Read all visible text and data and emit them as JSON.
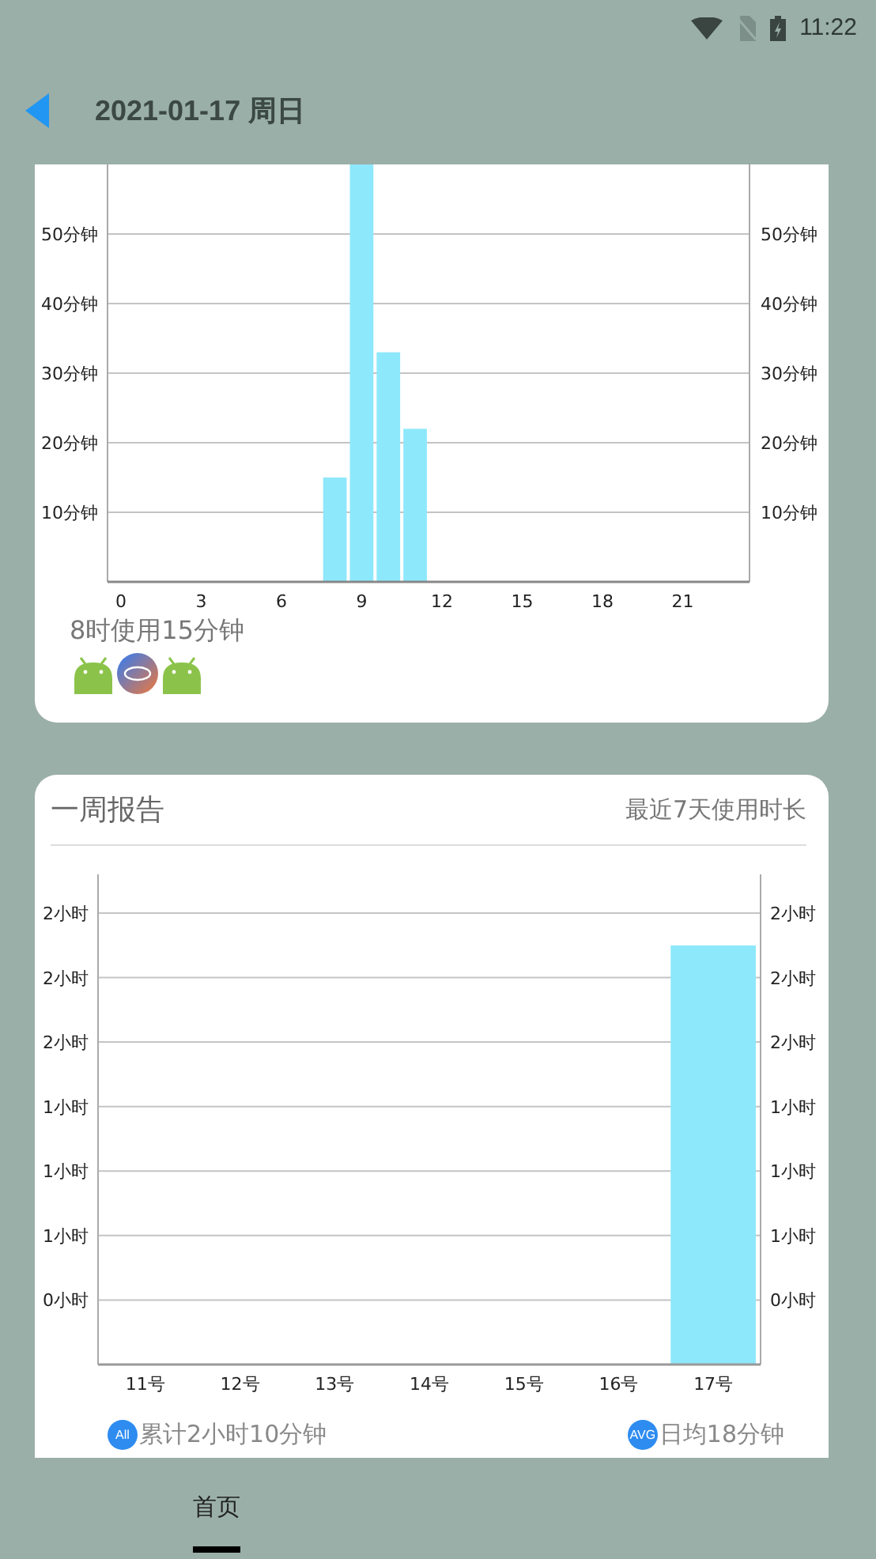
{
  "status_bar": {
    "time": "11:22"
  },
  "header": {
    "title": "2021-01-17 周日"
  },
  "day_card": {
    "chart_data": {
      "type": "bar",
      "x": [
        0,
        1,
        2,
        3,
        4,
        5,
        6,
        7,
        8,
        9,
        10,
        11,
        12,
        13,
        14,
        15,
        16,
        17,
        18,
        19,
        20,
        21,
        22,
        23
      ],
      "series": [
        {
          "color": "#8ee8fb",
          "values": [
            0,
            0,
            0,
            0,
            0,
            0,
            0,
            0,
            15,
            60,
            33,
            22,
            0,
            0,
            0,
            0,
            0,
            0,
            0,
            0,
            0,
            0,
            0,
            0
          ]
        }
      ],
      "grid": true,
      "xlim": [
        -0.5,
        23.5
      ],
      "ylim": [
        0,
        60
      ],
      "xticks": [
        0,
        3,
        6,
        9,
        12,
        15,
        18,
        21
      ],
      "yticks": [
        {
          "value": 10,
          "label": "10分钟"
        },
        {
          "value": 20,
          "label": "20分钟"
        },
        {
          "value": 30,
          "label": "30分钟"
        },
        {
          "value": 40,
          "label": "40分钟"
        },
        {
          "value": 50,
          "label": "50分钟"
        }
      ]
    },
    "caption": "8时使用15分钟",
    "apps": [
      {
        "kind": "android"
      },
      {
        "kind": "nox"
      },
      {
        "kind": "android"
      }
    ]
  },
  "week_card": {
    "title": "一周报告",
    "subtitle": "最近7天使用时长",
    "days": [
      "11号",
      "12号",
      "13号",
      "14号",
      "15号",
      "16号",
      "17号"
    ],
    "left_axis_labels": [
      "2小时",
      "2小时",
      "2小时",
      "1小时",
      "1小时",
      "1小时",
      "0小时"
    ],
    "right_axis_labels": [
      "2小时",
      "2小时",
      "2小时",
      "1小时",
      "1小时",
      "1小时",
      "0小时"
    ],
    "summary": [
      {
        "badge": "All",
        "text": "累计2小时10分钟"
      },
      {
        "badge": "AVG",
        "text": "日均18分钟"
      }
    ]
  },
  "bottom_nav": [
    {
      "label": "首页",
      "selected": true
    }
  ]
}
